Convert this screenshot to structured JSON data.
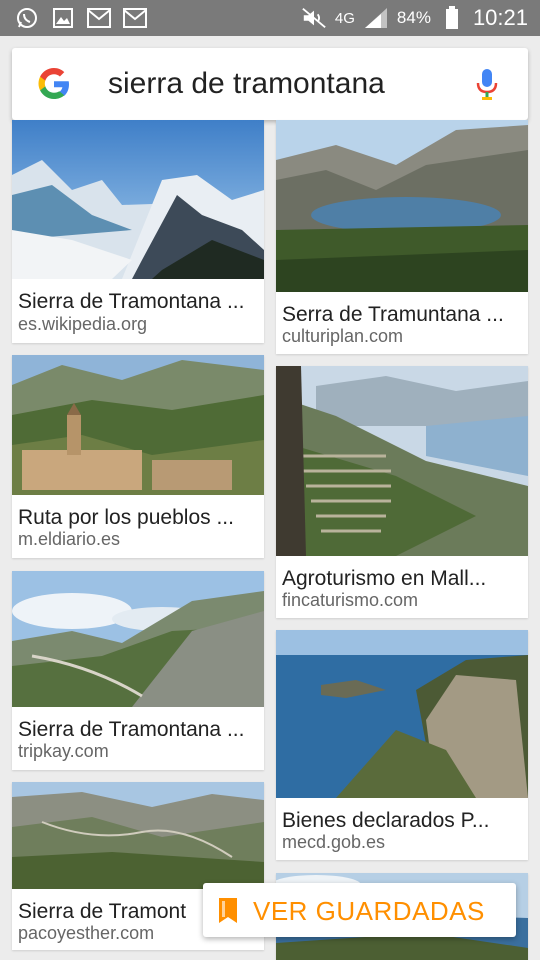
{
  "status_bar": {
    "network": "4G",
    "battery": "84%",
    "time": "10:21",
    "icons": [
      "whatsapp-icon",
      "gallery-icon",
      "gmail-icon",
      "gmail-icon",
      "mute-icon",
      "signal-icon",
      "battery-icon"
    ]
  },
  "search": {
    "query": "sierra de tramontana"
  },
  "results": [
    {
      "title": "Sierra de Tramontana ...",
      "source": "es.wikipedia.org"
    },
    {
      "title": "Serra de Tramuntana ...",
      "source": "culturiplan.com"
    },
    {
      "title": "Ruta por los pueblos ...",
      "source": "m.eldiario.es"
    },
    {
      "title": "Agroturismo en Mall...",
      "source": "fincaturismo.com"
    },
    {
      "title": "Sierra de Tramontana ...",
      "source": "tripkay.com"
    },
    {
      "title": "Bienes declarados P...",
      "source": "mecd.gob.es"
    },
    {
      "title": "Sierra de Tramont",
      "source": "pacoyesther.com"
    },
    {
      "title": "",
      "source": ""
    }
  ],
  "saved_button": {
    "label": "VER GUARDADAS"
  },
  "colors": {
    "accent": "#ff8f00",
    "status_bar": "#7a7a7a"
  }
}
